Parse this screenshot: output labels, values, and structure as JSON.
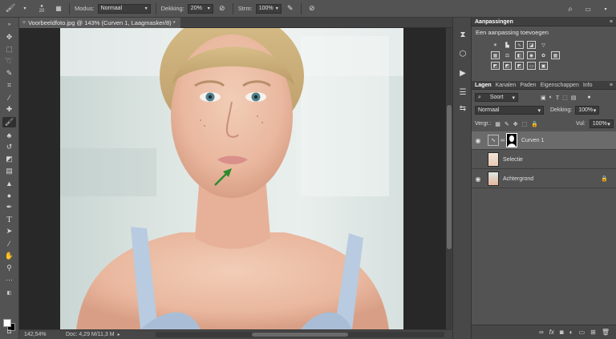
{
  "options_bar": {
    "brush_size": "20",
    "mode_label": "Modus:",
    "mode_value": "Normaal",
    "opacity_label": "Dekking:",
    "opacity_value": "20%",
    "flow_label": "Strm:",
    "flow_value": "100%"
  },
  "document": {
    "tab_title": "Voorbeeldfoto.jpg @ 143% (Curven 1, Laagmasker/8) *"
  },
  "status_bar": {
    "zoom": "142,54%",
    "doc_size": "Doc: 4,29 M/11,3 M"
  },
  "adjustments_panel": {
    "header": "Aanpassingen",
    "subtitle": "Een aanpassing toevoegen",
    "row1_icons": [
      "brightness-icon",
      "levels-icon",
      "curves-icon",
      "exposure-icon"
    ],
    "row2_icons": [
      "vibrance-icon",
      "hue-saturation-icon",
      "color-balance-icon",
      "black-white-icon",
      "photo-filter-icon",
      "channel-mixer-icon",
      "color-lookup-icon"
    ],
    "row3_icons": [
      "invert-icon",
      "posterize-icon",
      "threshold-icon",
      "gradient-map-icon",
      "selective-color-icon"
    ]
  },
  "layers_panel": {
    "tabs": [
      "Lagen",
      "Kanalen",
      "Paden",
      "Eigenschappen",
      "Info"
    ],
    "filter_label": "Soort",
    "blend_mode": "Normaal",
    "opacity_label": "Dekking:",
    "opacity_value": "100%",
    "lock_label": "Vergr.:",
    "fill_label": "Vul:",
    "fill_value": "100%",
    "layers": [
      {
        "name": "Curven 1",
        "visible": true,
        "selected": true
      },
      {
        "name": "Selectie",
        "visible": false,
        "selected": false
      },
      {
        "name": "Achtergrond",
        "visible": true,
        "selected": false,
        "locked": true
      }
    ]
  },
  "colors": {
    "ui_bg": "#535353",
    "canvas_bg": "#282828",
    "annotation_arrow": "#2e8b2e",
    "foreground_swatch": "#ffffff",
    "background_swatch": "#000000"
  }
}
